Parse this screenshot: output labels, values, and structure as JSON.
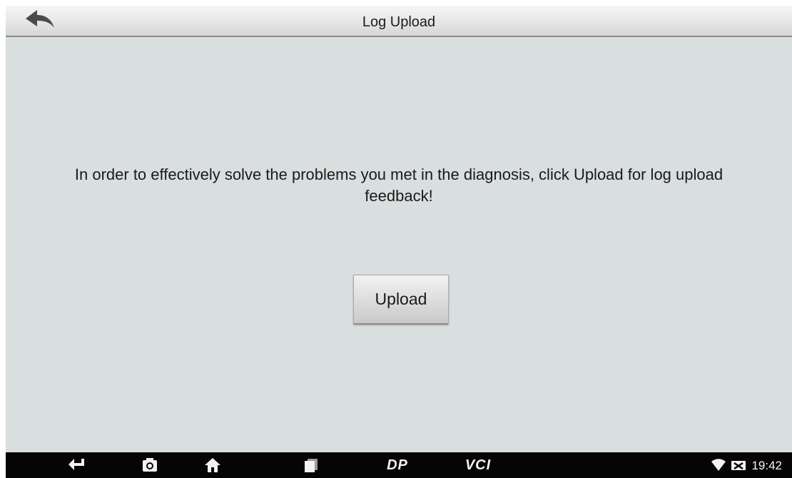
{
  "header": {
    "title": "Log Upload",
    "back_icon": "back-arrow-icon"
  },
  "main": {
    "message": "In order to effectively solve the problems you met in the diagnosis, click Upload for log upload feedback!",
    "upload_label": "Upload"
  },
  "navbar": {
    "icons": [
      "back-icon",
      "camera-icon",
      "home-icon",
      "recent-apps-icon",
      "dp-icon",
      "vci-icon"
    ],
    "dp_label": "DP",
    "vci_label": "VCI"
  },
  "status": {
    "time": "19:42",
    "icons": [
      "wifi-icon",
      "no-sim-icon"
    ]
  },
  "colors": {
    "background": "#d9dedf",
    "navbar": "#050505",
    "titlebar": "#e4e4e4"
  }
}
